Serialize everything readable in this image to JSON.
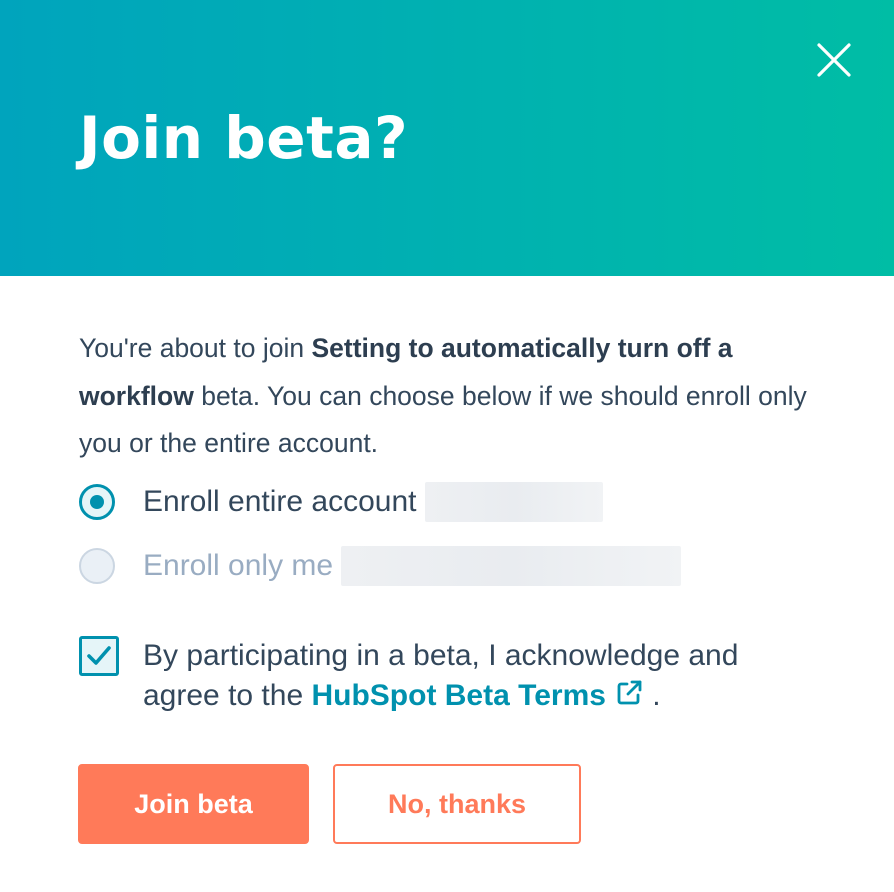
{
  "dialog": {
    "title": "Join beta?",
    "close_icon": "close-icon"
  },
  "body": {
    "intro_prefix": "You're about to join ",
    "beta_name": "Setting to automatically turn off a workflow",
    "intro_suffix": " beta. You can choose below if we should enroll only you or the entire account."
  },
  "enroll_options": [
    {
      "label": "Enroll entire account",
      "selected": true,
      "disabled": false
    },
    {
      "label": "Enroll only me",
      "selected": false,
      "disabled": true
    }
  ],
  "terms": {
    "checked": true,
    "text_prefix": "By participating in a beta, I acknowledge and agree to the ",
    "link_label": "HubSpot Beta Terms",
    "link_icon": "external-link-icon",
    "text_suffix": "."
  },
  "buttons": {
    "join_label": "Join beta",
    "decline_label": "No, thanks"
  },
  "colors": {
    "header_gradient_start": "#00a4bd",
    "header_gradient_end": "#00bda5",
    "primary_button": "#ff7a59",
    "link": "#0091ae",
    "text": "#33475b"
  }
}
